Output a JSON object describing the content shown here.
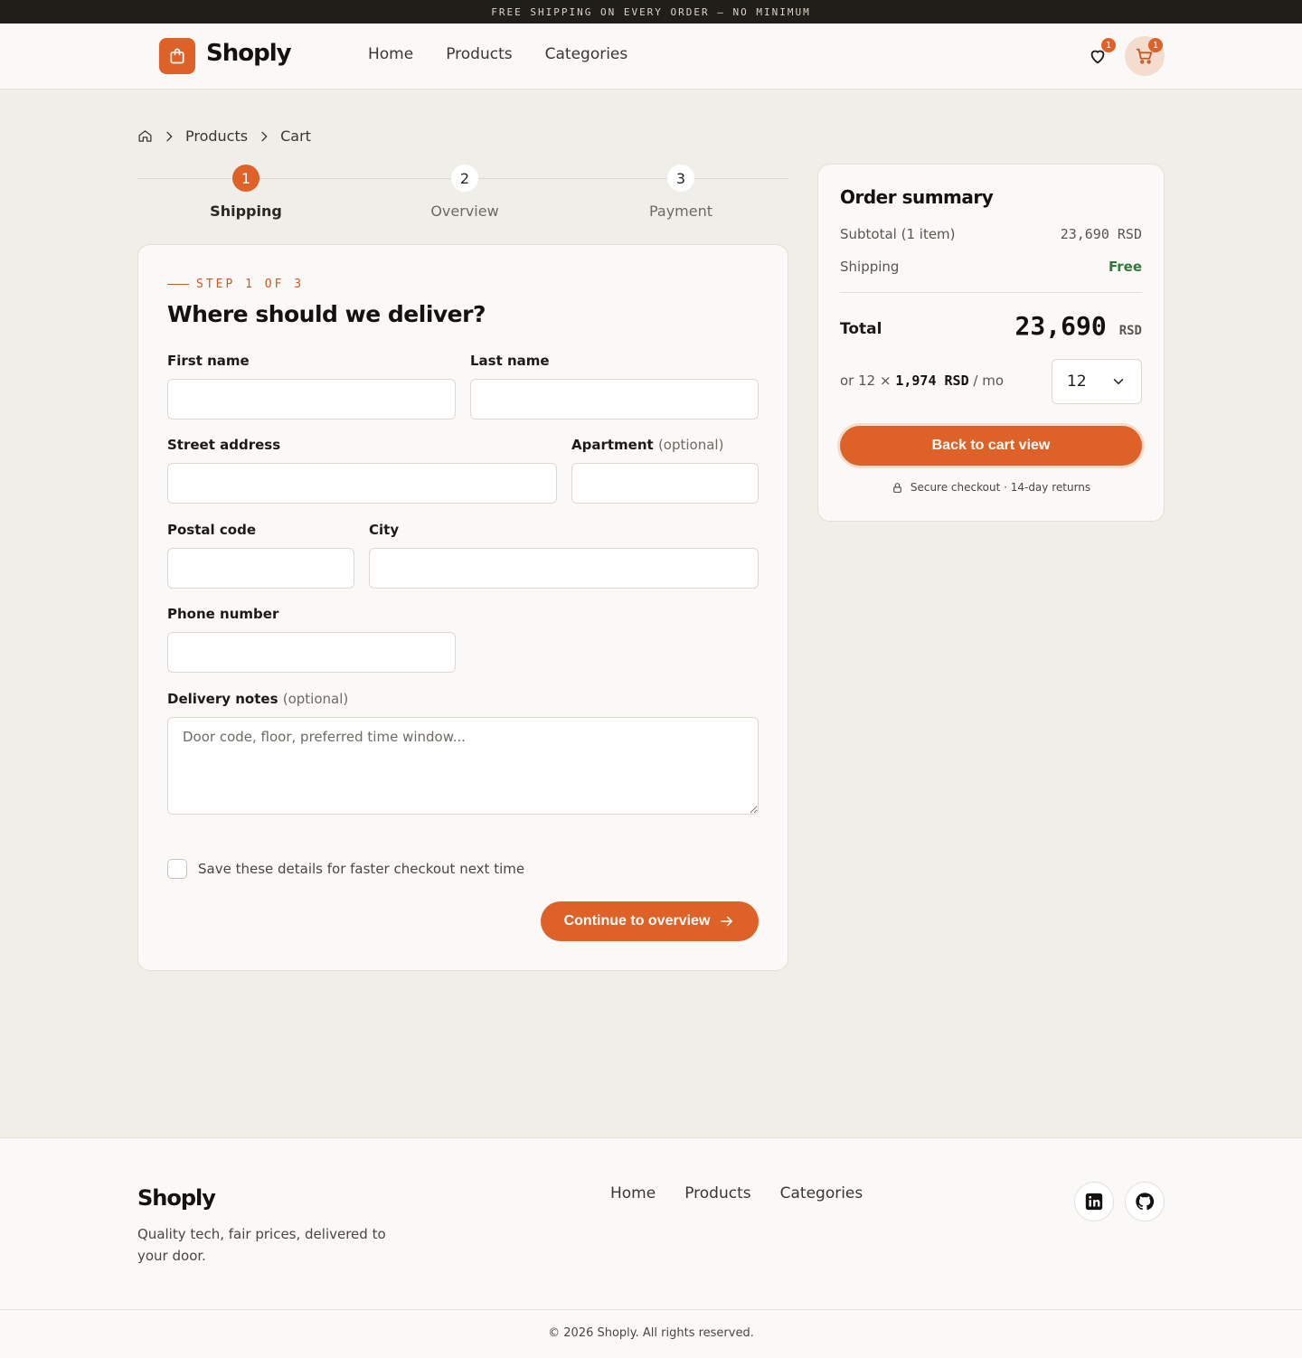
{
  "promo": {
    "text": "FREE SHIPPING ON EVERY ORDER — NO MINIMUM"
  },
  "header": {
    "logo_text": "Shoply",
    "nav": [
      "Home",
      "Products",
      "Categories"
    ],
    "wishlist_count": "1",
    "cart_count": "1"
  },
  "breadcrumb": {
    "items": [
      "Products",
      "Cart"
    ]
  },
  "steps": [
    {
      "number": "1",
      "label": "Shipping"
    },
    {
      "number": "2",
      "label": "Overview"
    },
    {
      "number": "3",
      "label": "Payment"
    }
  ],
  "form": {
    "eyebrow": "STEP 1 OF 3",
    "title": "Where should we deliver?",
    "first_name_label": "First name",
    "last_name_label": "Last name",
    "street_label": "Street address",
    "apartment_label": "Apartment",
    "optional_text": "(optional)",
    "postal_label": "Postal code",
    "city_label": "City",
    "phone_label": "Phone number",
    "notes_label": "Delivery notes",
    "notes_placeholder": "Door code, floor, preferred time window...",
    "save_label": "Save these details for faster checkout next time",
    "continue_label": "Continue to overview"
  },
  "summary": {
    "title": "Order summary",
    "subtotal_label": "Subtotal (1 item)",
    "subtotal_value": "23,690 RSD",
    "shipping_label": "Shipping",
    "shipping_value": "Free",
    "total_label": "Total",
    "total_value": "23,690",
    "total_currency": "RSD",
    "installment_prefix": "or 12 ×",
    "installment_amount": "1,974 RSD",
    "installment_suffix": "/ mo",
    "installments_selected": "12",
    "back_label": "Back to cart view",
    "secure_text": "Secure checkout · 14-day returns"
  },
  "footer": {
    "logo_text": "Shoply",
    "tagline": "Quality tech, fair prices, delivered to your door.",
    "nav": [
      "Home",
      "Products",
      "Categories"
    ],
    "copyright": "© 2026 Shoply. All rights reserved."
  },
  "colors": {
    "accent": "#de6228",
    "success": "#2f7a3c",
    "dark": "#211d18"
  }
}
